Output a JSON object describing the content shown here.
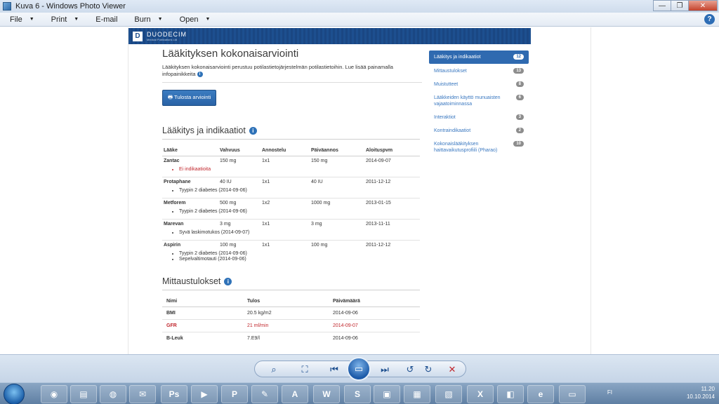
{
  "window": {
    "title": "Kuva 6 - Windows Photo Viewer",
    "minimize": "—",
    "maximize": "❐",
    "close": "✕"
  },
  "menu": {
    "items": [
      "File",
      "Print",
      "E-mail",
      "Burn",
      "Open"
    ],
    "help": "?"
  },
  "brand": {
    "logo": "D",
    "name": "DUODECIM",
    "sub": "Medical Publications Ltd"
  },
  "doc": {
    "title": "Lääkityksen kokonaisarviointi",
    "intro": "Lääkityksen kokonaisarviointi perustuu potilastietojärjestelmän potilastietoihin. Lue lisää painamalla infopainikkeita",
    "print_button": "Tulosta arviointi",
    "section1_title": "Lääkitys ja indikaatiot",
    "columns": [
      "Lääke",
      "Vahvuus",
      "Annostelu",
      "Päiväannos",
      "Aloituspvm"
    ],
    "rows": [
      {
        "drug": "Zantac",
        "strength": "150 mg",
        "dosing": "1x1",
        "daily": "150 mg",
        "start": "2014-09-07",
        "indications": [
          "Ei indikaatioita"
        ],
        "warn": true
      },
      {
        "drug": "Protaphane",
        "strength": "40 IU",
        "dosing": "1x1",
        "daily": "40 IU",
        "start": "2011-12-12",
        "indications": [
          "Tyypin 2 diabetes (2014-09-06)"
        ]
      },
      {
        "drug": "Metforem",
        "strength": "500 mg",
        "dosing": "1x2",
        "daily": "1000 mg",
        "start": "2013-01-15",
        "indications": [
          "Tyypin 2 diabetes (2014-09-06)"
        ]
      },
      {
        "drug": "Marevan",
        "strength": "3 mg",
        "dosing": "1x1",
        "daily": "3 mg",
        "start": "2013-11-11",
        "indications": [
          "Syvä laskimotukos (2014-09-07)"
        ]
      },
      {
        "drug": "Aspirin",
        "strength": "100 mg",
        "dosing": "1x1",
        "daily": "100 mg",
        "start": "2011-12-12",
        "indications": [
          "Tyypin 2 diabetes (2014-09-06)",
          "Sepelvaltimotauti (2014-09-06)"
        ]
      }
    ],
    "section2_title": "Mittaustulokset",
    "m_columns": [
      "Nimi",
      "Tulos",
      "Päivämäärä"
    ],
    "m_rows": [
      {
        "name": "BMI",
        "result": "20.5 kg/m2",
        "date": "2014-09-06"
      },
      {
        "name": "GFR",
        "result": "21 ml/min",
        "date": "2014-09-07",
        "warn": true
      },
      {
        "name": "B-Leuk",
        "result": "7.E9/l",
        "date": "2014-09-06"
      }
    ]
  },
  "nav": [
    {
      "label": "Lääkitys ja indikaatiot",
      "count": "12",
      "active": true
    },
    {
      "label": "Mittaustulokset",
      "count": "13"
    },
    {
      "label": "Muistutteet",
      "count": "8"
    },
    {
      "label": "Lääkkeiden käyttö munuaisten vajaatoiminnassa",
      "count": "6"
    },
    {
      "label": "Interaktiot",
      "count": "3"
    },
    {
      "label": "Kontraindikaatiot",
      "count": "2"
    },
    {
      "label": "Kokonaislääkityksen haittavaikutusprofiili (Pharao)",
      "count": "10"
    }
  ],
  "taskbar": {
    "lang": "FI",
    "time": "11.20",
    "date": "10.10.2014"
  },
  "colors": {
    "accent": "#2f6ab0",
    "warn": "#c1272d"
  }
}
